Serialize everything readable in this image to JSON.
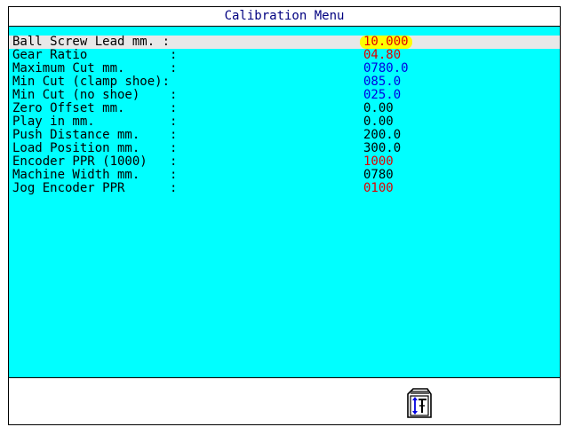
{
  "window": {
    "title": "Calibration Menu"
  },
  "colors": {
    "background": "#00ffff",
    "title_text": "#000080",
    "selected_row": "#e8e8e8",
    "highlight": "#ffff00"
  },
  "rows": [
    {
      "label": "Ball Screw Lead mm. :",
      "value": "10.000",
      "color": "#e00000",
      "selected": true
    },
    {
      "label": "Gear Ratio           :",
      "value": "04.80",
      "color": "#e00000",
      "selected": false
    },
    {
      "label": "Maximum Cut mm.      :",
      "value": "0780.0",
      "color": "#0000e0",
      "selected": false
    },
    {
      "label": "Min Cut (clamp shoe):",
      "value": "085.0",
      "color": "#0000e0",
      "selected": false
    },
    {
      "label": "Min Cut (no shoe)    :",
      "value": "025.0",
      "color": "#0000e0",
      "selected": false
    },
    {
      "label": "Zero Offset mm.      :",
      "value": "0.00",
      "color": "#000000",
      "selected": false
    },
    {
      "label": "Play in mm.          :",
      "value": "0.00",
      "color": "#000000",
      "selected": false
    },
    {
      "label": "Push Distance mm.    :",
      "value": "200.0",
      "color": "#000000",
      "selected": false
    },
    {
      "label": "Load Position mm.    :",
      "value": "300.0",
      "color": "#000000",
      "selected": false
    },
    {
      "label": "Encoder PPR (1000)   :",
      "value": "1000",
      "color": "#e00000",
      "selected": false
    },
    {
      "label": "Machine Width mm.    :",
      "value": "0780",
      "color": "#000000",
      "selected": false
    },
    {
      "label": "Jog Encoder PPR      :",
      "value": "0100",
      "color": "#e00000",
      "selected": false
    }
  ],
  "footer": {
    "icon": "calibration-tool-icon"
  }
}
